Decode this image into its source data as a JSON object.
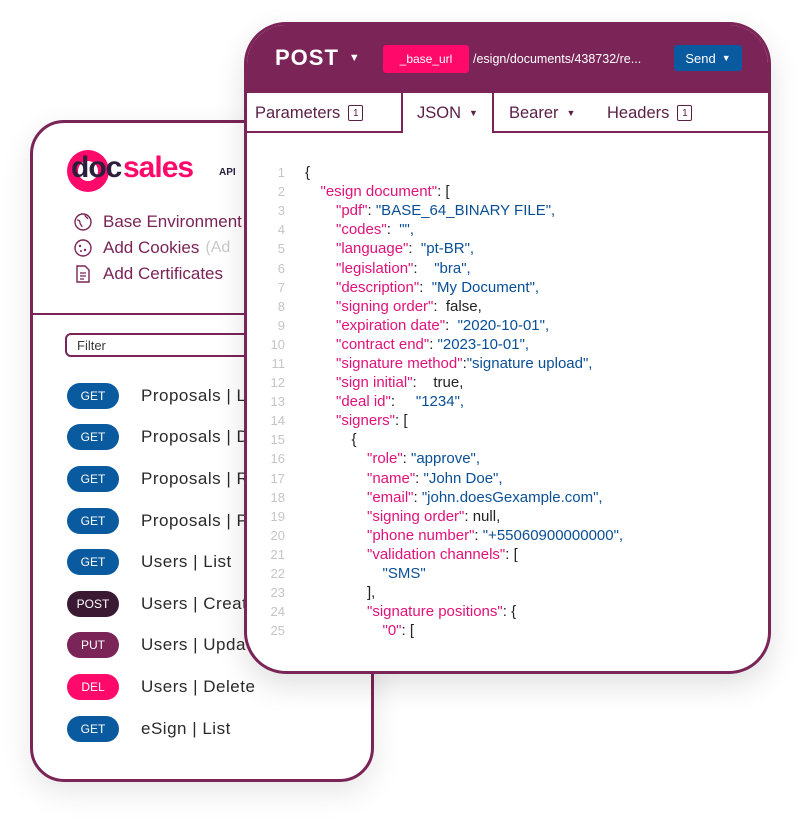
{
  "sidebar": {
    "logo": {
      "doc": "doc",
      "sales": "sales",
      "api": "API"
    },
    "env_items": [
      {
        "icon": "globe-icon",
        "label": "Base Environment",
        "hint": ""
      },
      {
        "icon": "cookie-icon",
        "label": "Add Cookies",
        "hint": "(Ad"
      },
      {
        "icon": "document-icon",
        "label": "Add Certificates",
        "hint": ""
      }
    ],
    "filter_placeholder": "Filter",
    "endpoints": [
      {
        "method": "GET",
        "color": "#0a5aa0",
        "name": "Proposals | L"
      },
      {
        "method": "GET",
        "color": "#0a5aa0",
        "name": "Proposals | D"
      },
      {
        "method": "GET",
        "color": "#0a5aa0",
        "name": "Proposals | R"
      },
      {
        "method": "GET",
        "color": "#0a5aa0",
        "name": "Proposals | P"
      },
      {
        "method": "GET",
        "color": "#0a5aa0",
        "name": "Users | List"
      },
      {
        "method": "POST",
        "color": "#3a1a33",
        "name": "Users | Creat"
      },
      {
        "method": "PUT",
        "color": "#7a2457",
        "name": "Users | Upda"
      },
      {
        "method": "DEL",
        "color": "#ff0a6a",
        "name": "Users | Delete"
      },
      {
        "method": "GET",
        "color": "#0a5aa0",
        "name": "eSign | List"
      }
    ]
  },
  "request": {
    "method": "POST",
    "base_url": "_base_url",
    "path": "/esign/documents/438732/re...",
    "send_label": "Send"
  },
  "tabs": [
    {
      "label": "Parameters",
      "count": "1",
      "caret": false,
      "active": false
    },
    {
      "label": "JSON",
      "count": "",
      "caret": true,
      "active": true
    },
    {
      "label": "Bearer",
      "count": "",
      "caret": true,
      "active": false
    },
    {
      "label": "Headers",
      "count": "1",
      "caret": false,
      "active": false
    }
  ],
  "code_lines": [
    {
      "n": "1",
      "indent": 0,
      "key": "",
      "sep": "{",
      "val": "",
      "vt": "p"
    },
    {
      "n": "2",
      "indent": 1,
      "key": "\"esign document\"",
      "sep": ": [",
      "val": "",
      "vt": "p"
    },
    {
      "n": "3",
      "indent": 2,
      "key": "\"pdf\"",
      "sep": ": ",
      "val": "\"BASE_64_BINARY FILE\",",
      "vt": "s"
    },
    {
      "n": "4",
      "indent": 2,
      "key": "\"codes\"",
      "sep": ":  ",
      "val": "\"\",",
      "vt": "s"
    },
    {
      "n": "5",
      "indent": 2,
      "key": "\"language\"",
      "sep": ":  ",
      "val": "\"pt-BR\",",
      "vt": "s"
    },
    {
      "n": "6",
      "indent": 2,
      "key": "\"legislation\"",
      "sep": ":    ",
      "val": "\"bra\",",
      "vt": "s"
    },
    {
      "n": "7",
      "indent": 2,
      "key": "\"description\"",
      "sep": ":  ",
      "val": "\"My Document\",",
      "vt": "s"
    },
    {
      "n": "8",
      "indent": 2,
      "key": "\"signing order\"",
      "sep": ":  ",
      "val": "false,",
      "vt": "p"
    },
    {
      "n": "9",
      "indent": 2,
      "key": "\"expiration date\"",
      "sep": ":  ",
      "val": "\"2020-10-01\",",
      "vt": "s"
    },
    {
      "n": "10",
      "indent": 2,
      "key": "\"contract end\"",
      "sep": ": ",
      "val": "\"2023-10-01\",",
      "vt": "s"
    },
    {
      "n": "11",
      "indent": 2,
      "key": "\"signature method\"",
      "sep": ":",
      "val": "\"signature upload\",",
      "vt": "s"
    },
    {
      "n": "12",
      "indent": 2,
      "key": "\"sign initial\"",
      "sep": ":    ",
      "val": "true,",
      "vt": "p"
    },
    {
      "n": "13",
      "indent": 2,
      "key": "\"deal id\"",
      "sep": ":     ",
      "val": "\"1234\",",
      "vt": "s"
    },
    {
      "n": "14",
      "indent": 2,
      "key": "\"signers\"",
      "sep": ": [",
      "val": "",
      "vt": "p"
    },
    {
      "n": "15",
      "indent": 3,
      "key": "",
      "sep": "{",
      "val": "",
      "vt": "p"
    },
    {
      "n": "16",
      "indent": 4,
      "key": "\"role\"",
      "sep": ": ",
      "val": "\"approve\",",
      "vt": "s"
    },
    {
      "n": "17",
      "indent": 4,
      "key": "\"name\"",
      "sep": ": ",
      "val": "\"John Doe\",",
      "vt": "s"
    },
    {
      "n": "18",
      "indent": 4,
      "key": "\"email\"",
      "sep": ": ",
      "val": "\"john.doesGexample.com\",",
      "vt": "s"
    },
    {
      "n": "19",
      "indent": 4,
      "key": "\"signing order\"",
      "sep": ": ",
      "val": "null,",
      "vt": "p"
    },
    {
      "n": "20",
      "indent": 4,
      "key": "\"phone number\"",
      "sep": ": ",
      "val": "\"+55060900000000\",",
      "vt": "s"
    },
    {
      "n": "21",
      "indent": 4,
      "key": "\"validation channels\"",
      "sep": ": [",
      "val": "",
      "vt": "p"
    },
    {
      "n": "22",
      "indent": 5,
      "key": "",
      "sep": "",
      "val": "\"SMS\"",
      "vt": "s"
    },
    {
      "n": "23",
      "indent": 4,
      "key": "",
      "sep": "],",
      "val": "",
      "vt": "p"
    },
    {
      "n": "24",
      "indent": 4,
      "key": "\"signature positions\"",
      "sep": ": {",
      "val": "",
      "vt": "p"
    },
    {
      "n": "25",
      "indent": 5,
      "key": "\"0\"",
      "sep": ": [",
      "val": "",
      "vt": "p"
    }
  ]
}
